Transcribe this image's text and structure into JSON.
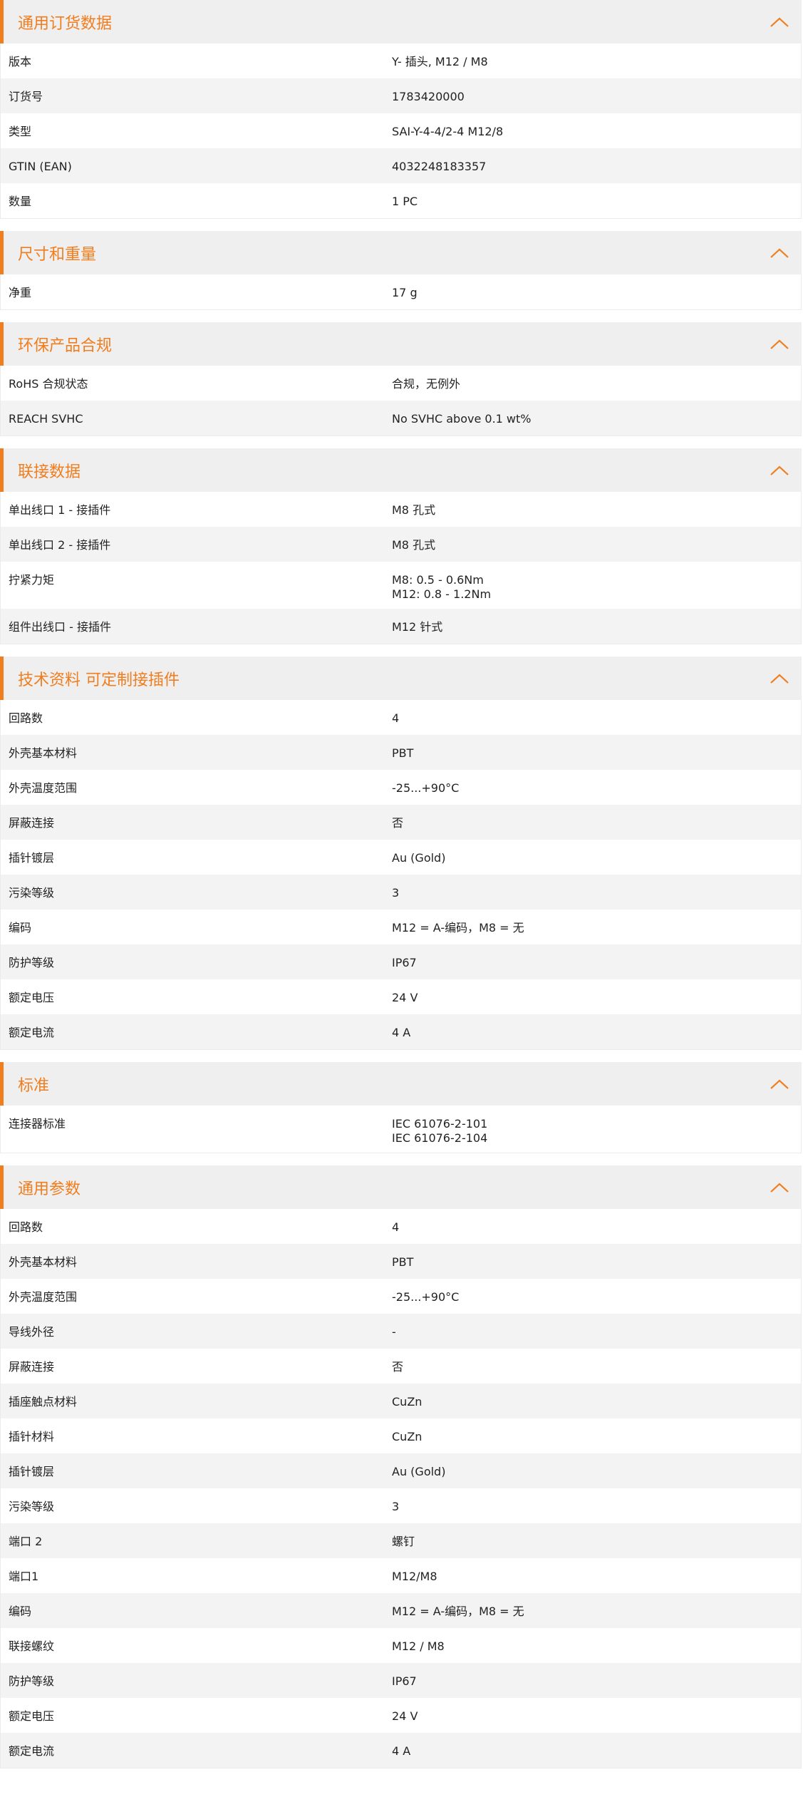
{
  "colors": {
    "accent": "#f07d1e",
    "header_bg": "#efefef",
    "row_alt_bg": "#f3f3f3",
    "text": "#222222"
  },
  "icons": {
    "collapse": "chevron-up-icon"
  },
  "sections": [
    {
      "title": "通用订货数据",
      "rows": [
        {
          "label": "版本",
          "value": "Y- 插头, M12 / M8"
        },
        {
          "label": "订货号",
          "value": "1783420000"
        },
        {
          "label": "类型",
          "value": "SAI-Y-4-4/2-4 M12/8"
        },
        {
          "label": "GTIN (EAN)",
          "value": "4032248183357"
        },
        {
          "label": "数量",
          "value": "1  PC"
        }
      ]
    },
    {
      "title": "尺寸和重量",
      "rows": [
        {
          "label": "净重",
          "value": "17  g"
        }
      ]
    },
    {
      "title": "环保产品合规",
      "rows": [
        {
          "label": "RoHS 合规状态",
          "value": "合规，无例外"
        },
        {
          "label": "REACH SVHC",
          "value": "No SVHC above 0.1 wt%"
        }
      ]
    },
    {
      "title": "联接数据",
      "rows": [
        {
          "label": "单出线口 1 - 接插件",
          "value": "M8 孔式"
        },
        {
          "label": "单出线口 2 - 接插件",
          "value": "M8 孔式"
        },
        {
          "label": "拧紧力矩",
          "value": "M8: 0.5 - 0.6Nm\nM12: 0.8 - 1.2Nm"
        },
        {
          "label": "组件出线口 - 接插件",
          "value": "M12 针式"
        }
      ]
    },
    {
      "title": "技术资料 可定制接插件",
      "rows": [
        {
          "label": "回路数",
          "value": "4"
        },
        {
          "label": "外壳基本材料",
          "value": "PBT"
        },
        {
          "label": "外壳温度范围",
          "value": "-25...+90°C"
        },
        {
          "label": "屏蔽连接",
          "value": "否"
        },
        {
          "label": "插针镀层",
          "value": "Au (Gold)"
        },
        {
          "label": "污染等级",
          "value": "3"
        },
        {
          "label": "编码",
          "value": "M12 = A-编码，M8 = 无"
        },
        {
          "label": "防护等级",
          "value": "IP67"
        },
        {
          "label": "额定电压",
          "value": "24  V"
        },
        {
          "label": "额定电流",
          "value": "4  A"
        }
      ]
    },
    {
      "title": "标准",
      "rows": [
        {
          "label": "连接器标准",
          "value": "IEC 61076-2-101\nIEC 61076-2-104"
        }
      ]
    },
    {
      "title": "通用参数",
      "rows": [
        {
          "label": "回路数",
          "value": "4"
        },
        {
          "label": "外壳基本材料",
          "value": "PBT"
        },
        {
          "label": "外壳温度范围",
          "value": "-25...+90°C"
        },
        {
          "label": "导线外径",
          "value": "-"
        },
        {
          "label": "屏蔽连接",
          "value": "否"
        },
        {
          "label": "插座触点材料",
          "value": "CuZn"
        },
        {
          "label": "插针材料",
          "value": "CuZn"
        },
        {
          "label": "插针镀层",
          "value": "Au (Gold)"
        },
        {
          "label": "污染等级",
          "value": "3"
        },
        {
          "label": "端口 2",
          "value": "螺钉"
        },
        {
          "label": "端口1",
          "value": "M12/M8"
        },
        {
          "label": "编码",
          "value": "M12 = A-编码，M8 = 无"
        },
        {
          "label": "联接螺纹",
          "value": "M12 / M8"
        },
        {
          "label": "防护等级",
          "value": "IP67"
        },
        {
          "label": "额定电压",
          "value": "24  V"
        },
        {
          "label": "额定电流",
          "value": "4  A"
        }
      ]
    }
  ]
}
